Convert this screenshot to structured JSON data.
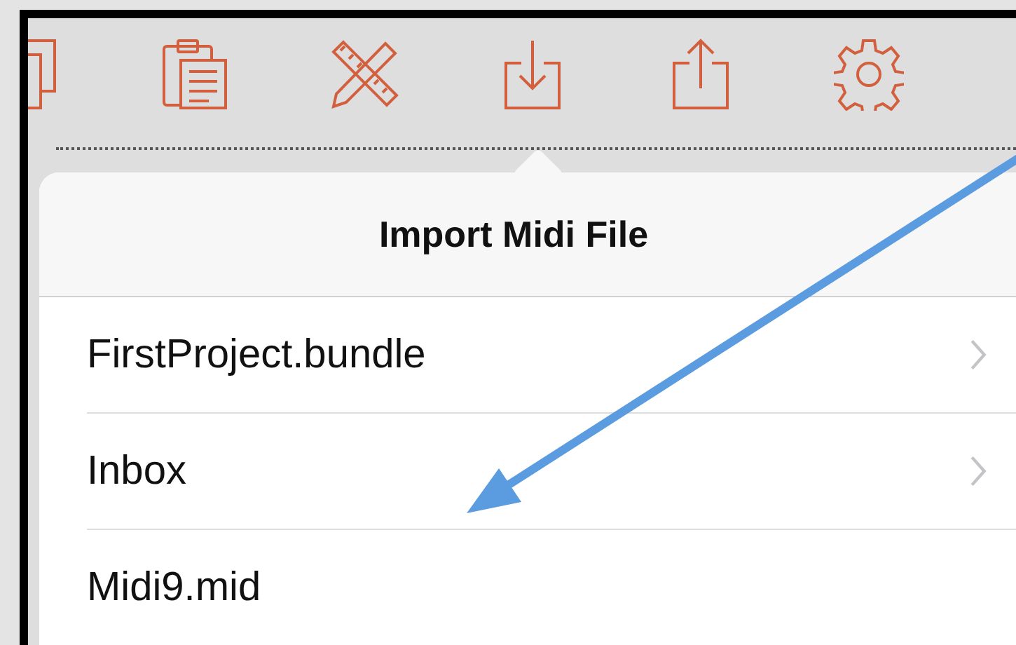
{
  "popover": {
    "title": "Import Midi File",
    "items": [
      {
        "label": "FirstProject.bundle",
        "kind": "folder"
      },
      {
        "label": "Inbox",
        "kind": "folder"
      },
      {
        "label": "Midi9.mid",
        "kind": "file"
      }
    ]
  }
}
